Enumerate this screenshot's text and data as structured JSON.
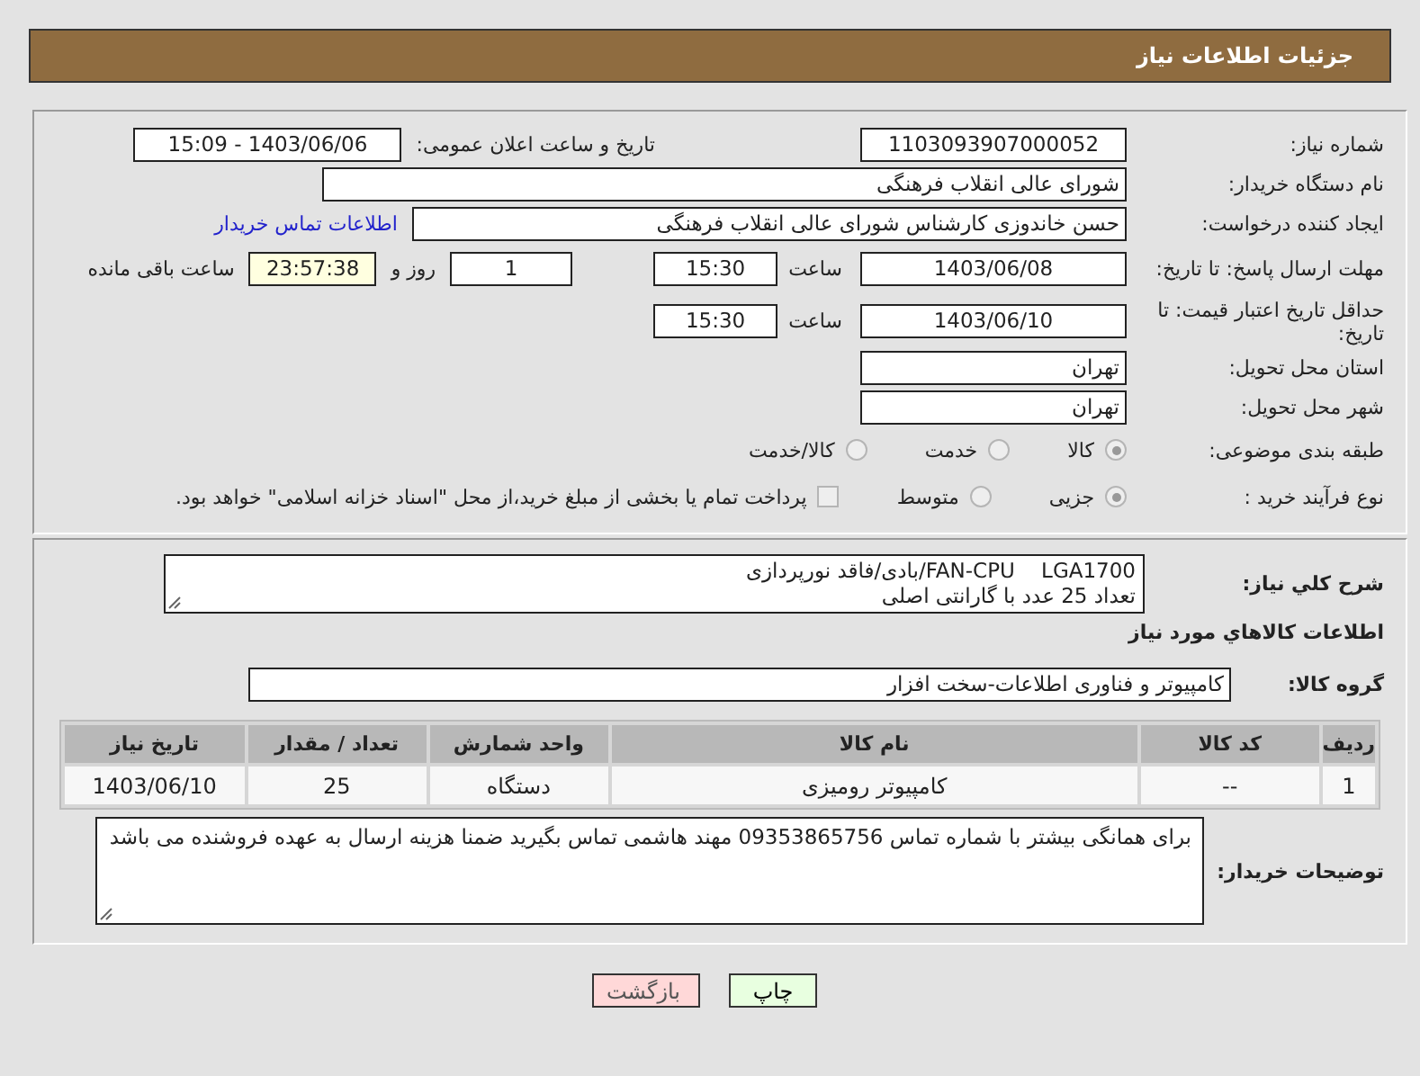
{
  "header": {
    "title": "جزئیات اطلاعات نیاز"
  },
  "info": {
    "need_number": {
      "label": "شماره نیاز:",
      "value": "1103093907000052"
    },
    "announce": {
      "label": "تاریخ و ساعت اعلان عمومی:",
      "value": "1403/06/06 - 15:09"
    },
    "buyer_org": {
      "label": "نام دستگاه خریدار:",
      "value": "شورای عالی انقلاب فرهنگی"
    },
    "requester": {
      "label": "ایجاد کننده درخواست:",
      "value": "حسن خاندوزی کارشناس شورای عالی انقلاب فرهنگی",
      "link": "اطلاعات تماس خریدار"
    },
    "reply_deadline": {
      "label": "مهلت ارسال پاسخ: تا تاریخ:",
      "date": "1403/06/08",
      "time_label": "ساعت",
      "time": "15:30",
      "days": "1",
      "days_label": "روز و",
      "remaining": "23:57:38",
      "remaining_label": "ساعت باقی مانده"
    },
    "price_validity": {
      "label": "حداقل تاریخ اعتبار قیمت: تا تاریخ:",
      "date": "1403/06/10",
      "time_label": "ساعت",
      "time": "15:30"
    },
    "province": {
      "label": "استان محل تحویل:",
      "value": "تهران"
    },
    "city": {
      "label": "شهر محل تحویل:",
      "value": "تهران"
    },
    "category": {
      "label": "طبقه بندی موضوعی:",
      "options": [
        {
          "label": "کالا",
          "selected": true
        },
        {
          "label": "خدمت",
          "selected": false
        },
        {
          "label": "کالا/خدمت",
          "selected": false
        }
      ]
    },
    "purchase_process": {
      "label": "نوع فرآیند خرید :",
      "options": [
        {
          "label": "جزیی",
          "selected": true
        },
        {
          "label": "متوسط",
          "selected": false
        }
      ],
      "payment": {
        "label": "پرداخت تمام یا بخشی از مبلغ خرید،از محل \"اسناد خزانه اسلامی\" خواهد بود.",
        "checked": false
      }
    }
  },
  "goods": {
    "description": {
      "label": "شرح کلي نياز:",
      "lines": [
        "FAN-CPU    LGA1700/بادی/فاقد نورپردازی",
        "تعداد 25 عدد با گارانتی اصلی"
      ]
    },
    "heading": "اطلاعات کالاهاي مورد نياز",
    "group": {
      "label": "گروه کالا:",
      "value": "کامپیوتر و فناوری اطلاعات-سخت افزار"
    },
    "table": {
      "columns": [
        "ردیف",
        "کد کالا",
        "نام کالا",
        "واحد شمارش",
        "تعداد / مقدار",
        "تاریخ نیاز"
      ],
      "rows": [
        [
          "1",
          "--",
          "کامپیوتر رومیزی",
          "دستگاه",
          "25",
          "1403/06/10"
        ]
      ]
    },
    "buyer_notes": {
      "label": "توضیحات خریدار:",
      "value": "برای همانگی بیشتر با شماره تماس 09353865756 مهند هاشمی تماس بگیرید ضمنا هزینه ارسال به عهده فروشنده می باشد"
    }
  },
  "buttons": [
    {
      "label": "چاپ",
      "kind": "print"
    },
    {
      "label": "بازگشت",
      "kind": "back"
    }
  ]
}
